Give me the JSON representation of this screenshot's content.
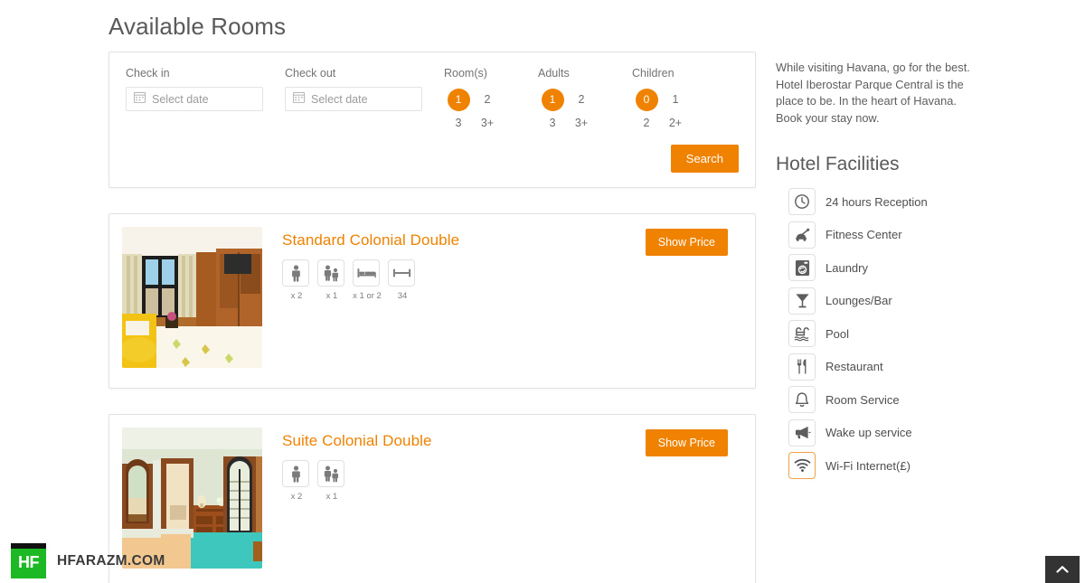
{
  "main": {
    "page_title": "Available Rooms"
  },
  "search": {
    "checkin": {
      "label": "Check in",
      "placeholder": "Select date",
      "value": "",
      "icon": "calendar-icon"
    },
    "checkout": {
      "label": "Check out",
      "placeholder": "Select date",
      "value": "",
      "icon": "calendar-icon"
    },
    "rooms": {
      "label": "Room(s)",
      "options": [
        "1",
        "2",
        "3",
        "3+"
      ],
      "selected": "1"
    },
    "adults": {
      "label": "Adults",
      "options": [
        "1",
        "2",
        "3",
        "3+"
      ],
      "selected": "1"
    },
    "children": {
      "label": "Children",
      "options": [
        "0",
        "1",
        "2",
        "2+"
      ],
      "selected": "0"
    },
    "search_button": "Search"
  },
  "rooms": [
    {
      "title": "Standard Colonial Double",
      "show_price_label": "Show Price",
      "amenities": [
        {
          "icon": "adult-icon",
          "caption": "x 2"
        },
        {
          "icon": "family-icon",
          "caption": "x 1"
        },
        {
          "icon": "bed-icon",
          "caption": "x 1 or 2"
        },
        {
          "icon": "room-size-icon",
          "caption": "34"
        }
      ]
    },
    {
      "title": "Suite Colonial Double",
      "show_price_label": "Show Price",
      "amenities": [
        {
          "icon": "adult-icon",
          "caption": "x 2"
        },
        {
          "icon": "family-icon",
          "caption": "x 1"
        }
      ]
    }
  ],
  "sidebar": {
    "intro": "While visiting Havana, go for the best. Hotel Iberostar Parque Central is the place to be. In the heart of Havana. Book your stay now.",
    "facilities_title": "Hotel Facilities",
    "facilities": [
      {
        "icon": "clock-icon",
        "label": "24 hours Reception",
        "highlighted": false
      },
      {
        "icon": "fitness-icon",
        "label": "Fitness Center",
        "highlighted": false
      },
      {
        "icon": "laundry-icon",
        "label": "Laundry",
        "highlighted": false
      },
      {
        "icon": "cocktail-icon",
        "label": "Lounges/Bar",
        "highlighted": false
      },
      {
        "icon": "pool-icon",
        "label": "Pool",
        "highlighted": false
      },
      {
        "icon": "restaurant-icon",
        "label": "Restaurant",
        "highlighted": false
      },
      {
        "icon": "bell-icon",
        "label": "Room Service",
        "highlighted": false
      },
      {
        "icon": "megaphone-icon",
        "label": "Wake up service",
        "highlighted": false
      },
      {
        "icon": "wifi-icon",
        "label": "Wi-Fi Internet(£)",
        "highlighted": true
      }
    ]
  },
  "watermark": {
    "logo_text": "HF",
    "site_text": "HFARAZM.COM"
  },
  "scroll_top": {
    "icon": "chevron-up-icon"
  },
  "colors": {
    "accent": "#ef8200",
    "title_gray": "#5a5a5a",
    "border": "#e2e2e2",
    "logo_green": "#1db924"
  }
}
